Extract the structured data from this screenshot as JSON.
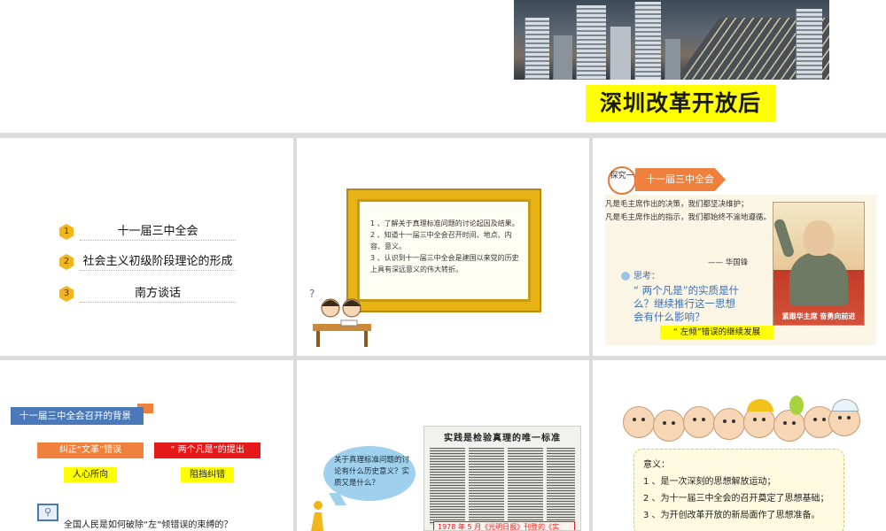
{
  "top_slide": {
    "title": "深圳改革开放后"
  },
  "slide1": {
    "items": [
      {
        "num": "1",
        "label": "十一届三中全会"
      },
      {
        "num": "2",
        "label": "社会主义初级阶段理论的形成"
      },
      {
        "num": "3",
        "label": "南方谈话"
      }
    ]
  },
  "slide2": {
    "goals": [
      "1 、了解关于真理标准问题的讨论起因及结果。",
      "2 、知道十一届三中全会召开时间、地点、内容、意义。",
      "3 、认识到十一届三中全会是建国以来党的历史上具有深远意义的伟大转折。"
    ]
  },
  "slide3": {
    "badge": "探究一",
    "tag": "十一届三中全会",
    "quote_line1": "凡是毛主席作出的决策，我们都坚决维护；",
    "quote_line2": "凡是毛主席作出的指示，我们都始终不渝地遵循。",
    "quote_author": "—— 华国锋",
    "think_label": "思考：",
    "think_question": "“ 两个凡是”的实质是什么？继续推行这一思想会有什么影响？",
    "answer": "“ 左倾”错误的继续发展",
    "poster_caption": "紧跟华主席  奋勇向前进"
  },
  "slide4": {
    "header": "十一届三中全会召开的背景",
    "left_box": "纠正“文革”错误",
    "right_box": "“ 两个凡是”的提出",
    "left_sub": "人心所向",
    "right_sub": "阻挡纠错",
    "question": "全国人民是如何破除“左”倾错误的束缚的？"
  },
  "slide5": {
    "bubble": "关于真理标准问题的讨论有什么历史意义？实质又是什么？",
    "paper_title": "实践是检验真理的唯一标准",
    "paper_footer": "1978 年 5 月《光明日报》刊登的《实"
  },
  "slide6": {
    "title": "意义：",
    "points": [
      "1 、是一次深刻的思想解放运动；",
      "2 、为十一届三中全会的召开奠定了思想基础；",
      "3 、为开创改革开放的新局面作了思想准备。"
    ]
  }
}
